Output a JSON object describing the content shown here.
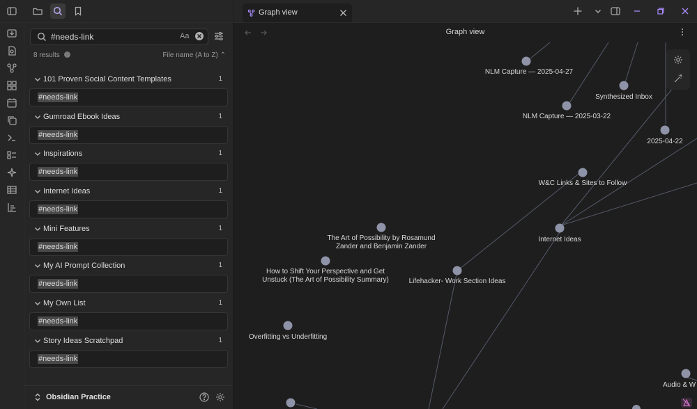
{
  "search": {
    "value": "#needs-link",
    "case_label": "Aa"
  },
  "results_meta": {
    "count": "8 results",
    "sort": "File name (A to Z)"
  },
  "results": [
    {
      "title": "101 Proven Social Content Templates",
      "count": "1",
      "match": "#needs-link"
    },
    {
      "title": "Gumroad Ebook Ideas",
      "count": "1",
      "match": "#needs-link"
    },
    {
      "title": "Inspirations",
      "count": "1",
      "match": "#needs-link"
    },
    {
      "title": "Internet Ideas",
      "count": "1",
      "match": "#needs-link"
    },
    {
      "title": "Mini Features",
      "count": "1",
      "match": "#needs-link"
    },
    {
      "title": "My AI Prompt Collection",
      "count": "1",
      "match": "#needs-link"
    },
    {
      "title": "My Own List",
      "count": "1",
      "match": "#needs-link"
    },
    {
      "title": "Story Ideas Scratchpad",
      "count": "1",
      "match": "#needs-link"
    }
  ],
  "vault": {
    "name": "Obsidian Practice"
  },
  "tab": {
    "title": "Graph view"
  },
  "view": {
    "title": "Graph view"
  },
  "graph": {
    "nodes": [
      {
        "label": "NLM Capture — 2025-04-27"
      },
      {
        "label": "Synthesized Inbox"
      },
      {
        "label": "NLM Capture — 2025-03-22"
      },
      {
        "label": "2025-04-22"
      },
      {
        "label": "W&C Links & Sites to Follow"
      },
      {
        "label": "The Art of Possibility by Rosamund\nZander and Benjamin Zander"
      },
      {
        "label": "Internet Ideas"
      },
      {
        "label": "How to Shift Your Perspective and Get\nUnstuck (The Art of Possibility Summary)"
      },
      {
        "label": "Lifehacker- Work Section Ideas"
      },
      {
        "label": "Overfitting vs Underfitting"
      },
      {
        "label": "Audio & W"
      }
    ]
  },
  "colors": {
    "accent": "#a88bfa",
    "node": "#8f93a8",
    "edge": "#555a6a"
  },
  "icons": {
    "ribbon": [
      "sidebar-toggle-icon",
      "folder-icon",
      "search-icon",
      "bookmark-icon"
    ],
    "rail": [
      "download-icon",
      "file-search-icon",
      "graph-icon",
      "layout-grid-icon",
      "calendar-icon",
      "copy-icon",
      "terminal-icon",
      "list-icon",
      "sparkles-icon",
      "table-icon",
      "chart-icon"
    ]
  }
}
